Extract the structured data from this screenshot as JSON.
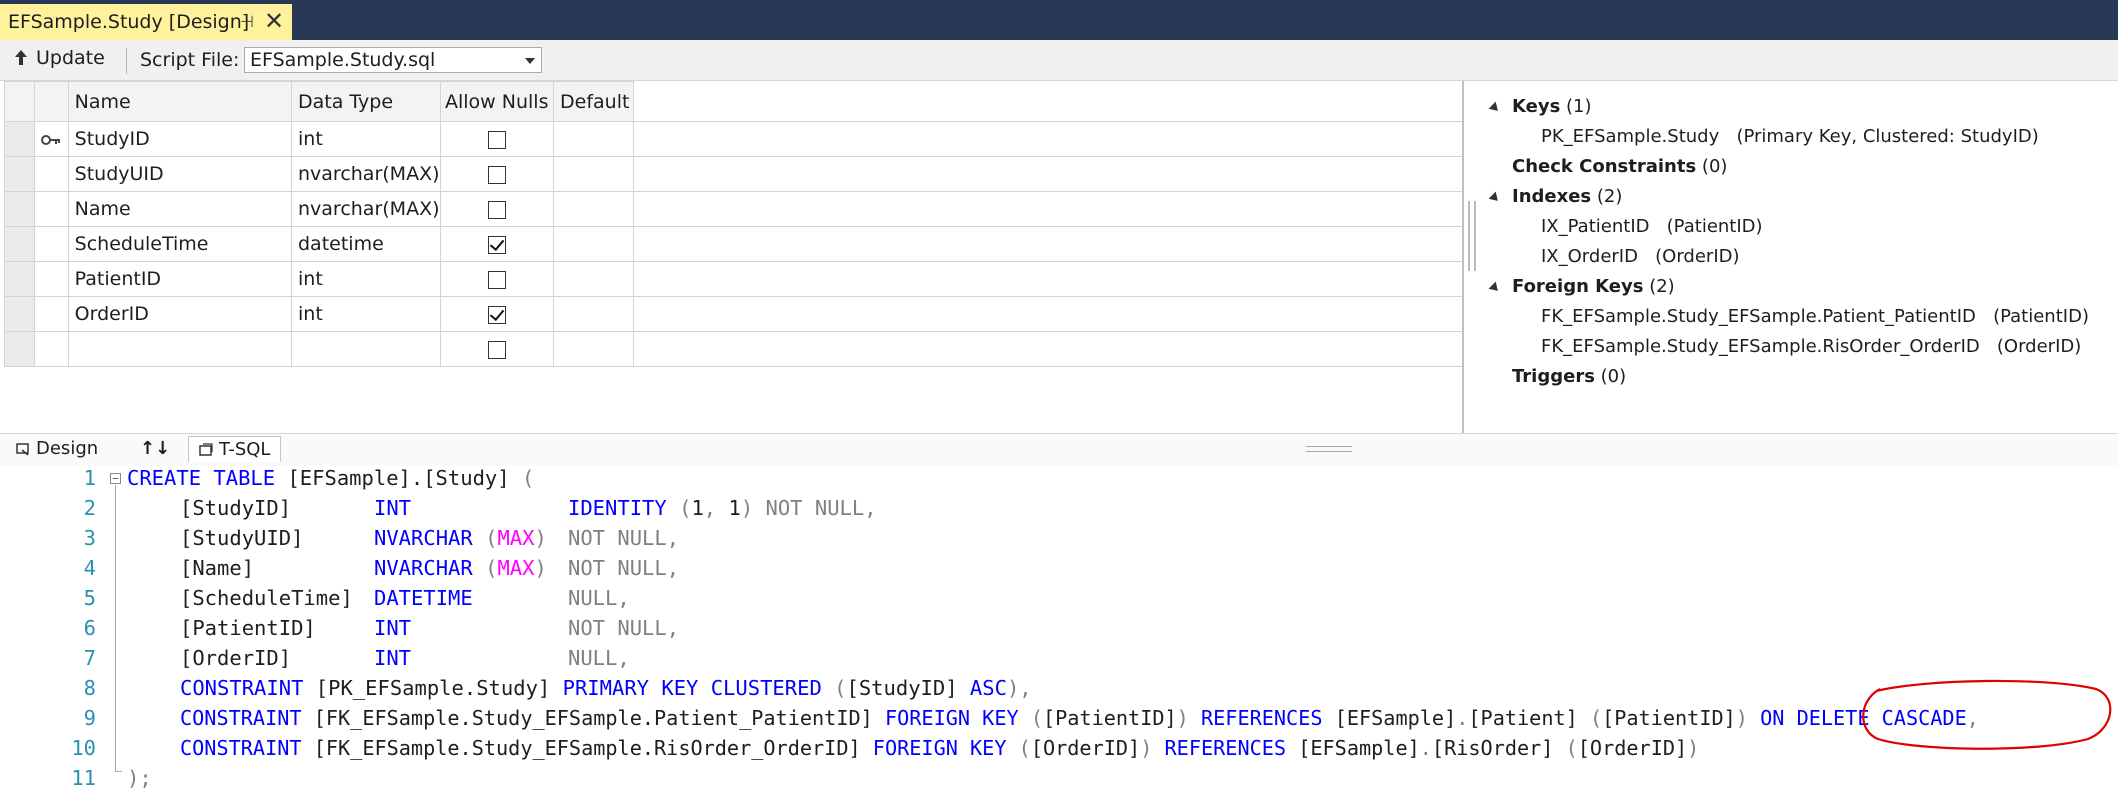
{
  "doc_tab": {
    "title": "EFSample.Study [Design]"
  },
  "toolbar": {
    "update_label": "Update",
    "script_file_label": "Script File:",
    "script_file_value": "EFSample.Study.sql"
  },
  "grid": {
    "headers": {
      "name": "Name",
      "data_type": "Data Type",
      "allow_nulls": "Allow Nulls",
      "default": "Default"
    },
    "rows": [
      {
        "name": "StudyID",
        "type": "int",
        "allow_nulls": false,
        "primary_key": true
      },
      {
        "name": "StudyUID",
        "type": "nvarchar(MAX)",
        "allow_nulls": false
      },
      {
        "name": "Name",
        "type": "nvarchar(MAX)",
        "allow_nulls": false
      },
      {
        "name": "ScheduleTime",
        "type": "datetime",
        "allow_nulls": true
      },
      {
        "name": "PatientID",
        "type": "int",
        "allow_nulls": false
      },
      {
        "name": "OrderID",
        "type": "int",
        "allow_nulls": true
      },
      {
        "name": "",
        "type": "",
        "allow_nulls": false
      }
    ]
  },
  "properties": {
    "keys": {
      "label": "Keys",
      "count": "(1)",
      "items": [
        {
          "name": "PK_EFSample.Study",
          "detail": "(Primary Key, Clustered: StudyID)"
        }
      ]
    },
    "check_constraints": {
      "label": "Check Constraints",
      "count": "(0)"
    },
    "indexes": {
      "label": "Indexes",
      "count": "(2)",
      "items": [
        {
          "name": "IX_PatientID",
          "detail": "(PatientID)"
        },
        {
          "name": "IX_OrderID",
          "detail": "(OrderID)"
        }
      ]
    },
    "foreign_keys": {
      "label": "Foreign Keys",
      "count": "(2)",
      "items": [
        {
          "name": "FK_EFSample.Study_EFSample.Patient_PatientID",
          "detail": "(PatientID)"
        },
        {
          "name": "FK_EFSample.Study_EFSample.RisOrder_OrderID",
          "detail": "(OrderID)"
        }
      ]
    },
    "triggers": {
      "label": "Triggers",
      "count": "(0)"
    }
  },
  "bottom_tabs": {
    "design": "Design",
    "swap": "↑↓",
    "tsql": "T-SQL"
  },
  "editor": {
    "line_numbers": [
      "1",
      "2",
      "3",
      "4",
      "5",
      "6",
      "7",
      "8",
      "9",
      "10",
      "11"
    ],
    "line1": {
      "kw": "CREATE TABLE",
      "txt": "[EFSample].[Study]",
      "p": "("
    },
    "line2": {
      "id": "[StudyID]",
      "type": "INT",
      "ident": "IDENTITY",
      "p1": "(",
      "a": "1",
      "c": ",",
      "b": "1",
      "p2": ")",
      "nn": "NOT NULL,"
    },
    "line3": {
      "id": "[StudyUID]",
      "type": "NVARCHAR",
      "p1": "(",
      "max": "MAX",
      "p2": ")",
      "nn": "NOT NULL,"
    },
    "line4": {
      "id": "[Name]",
      "type": "NVARCHAR",
      "p1": "(",
      "max": "MAX",
      "p2": ")",
      "nn": "NOT NULL,"
    },
    "line5": {
      "id": "[ScheduleTime]",
      "type": "DATETIME",
      "nn": "NULL,"
    },
    "line6": {
      "id": "[PatientID]",
      "type": "INT",
      "nn": "NOT NULL,"
    },
    "line7": {
      "id": "[OrderID]",
      "type": "INT",
      "nn": "NULL,"
    },
    "line8": {
      "c": "CONSTRAINT",
      "name": "[PK_EFSample.Study]",
      "k": "PRIMARY KEY CLUSTERED",
      "p1": "(",
      "col": "[StudyID]",
      "asc": "ASC",
      "p2": "),"
    },
    "line9": {
      "c": "CONSTRAINT",
      "name": "[FK_EFSample.Study_EFSample.Patient_PatientID]",
      "k": "FOREIGN KEY",
      "p1": "(",
      "col": "[PatientID]",
      "p2": ")",
      "ref": "REFERENCES",
      "tbl": "[EFSample]",
      "dot": ".",
      "tbl2": "[Patient]",
      "p3": "(",
      "col2": "[PatientID]",
      "p4": ")",
      "cascade": "ON DELETE CASCADE",
      "comma": ","
    },
    "line10": {
      "c": "CONSTRAINT",
      "name": "[FK_EFSample.Study_EFSample.RisOrder_OrderID]",
      "k": "FOREIGN KEY",
      "p1": "(",
      "col": "[OrderID]",
      "p2": ")",
      "ref": "REFERENCES",
      "tbl": "[EFSample]",
      "dot": ".",
      "tbl2": "[RisOrder]",
      "p3": "(",
      "col2": "[OrderID]",
      "p4": ")"
    },
    "line11": {
      "p": ");"
    }
  },
  "colors": {
    "tab_bg": "#293955",
    "active_tab": "#fff29d",
    "keyword": "#0000ff",
    "gray": "#808080",
    "function": "#ff00ff",
    "line_number": "#2b91af",
    "annotation": "#e00000"
  }
}
